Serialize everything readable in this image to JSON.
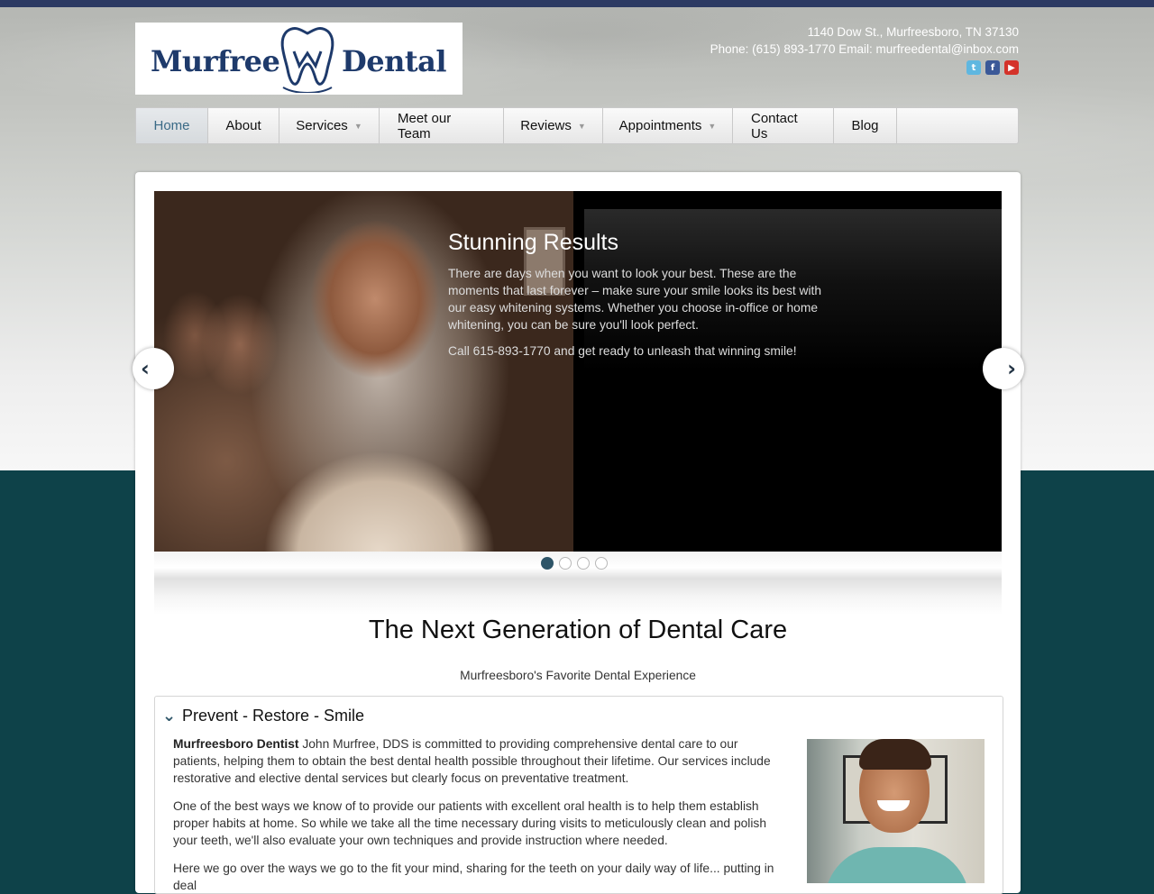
{
  "brand": {
    "name_left": "Murfree",
    "name_right": "Dental"
  },
  "header": {
    "address": "1140 Dow St., Murfreesboro, TN 37130",
    "phone_email": "Phone: (615) 893-1770 Email: murfreedental@inbox.com",
    "social": [
      "twitter-icon",
      "facebook-icon",
      "youtube-icon"
    ]
  },
  "nav": {
    "items": [
      {
        "label": "Home",
        "active": true
      },
      {
        "label": "About"
      },
      {
        "label": "Services",
        "dropdown": true
      },
      {
        "label": "Meet our Team"
      },
      {
        "label": "Reviews",
        "dropdown": true
      },
      {
        "label": "Appointments",
        "dropdown": true
      },
      {
        "label": "Contact Us"
      },
      {
        "label": "Blog"
      }
    ]
  },
  "slider": {
    "title": "Stunning Results",
    "text": "There are days when you want to look your best.  These are the moments that last forever – make sure your smile looks its best with our easy whitening systems.  Whether you choose in-office or home whitening, you can be sure you'll look perfect.",
    "cta": "Call 615-893-1770 and get ready to unleash that winning smile!",
    "slides": 4,
    "active_slide": 1
  },
  "main": {
    "tagline": "The Next Generation of Dental Care",
    "subtag": "Murfreesboro's Favorite Dental Experience",
    "section_title": "Prevent - Restore - Smile",
    "p1_bold": "Murfreesboro Dentist",
    "p1_rest": " John Murfree, DDS is committed to providing comprehensive dental care to our patients, helping them to obtain the best dental health possible throughout their lifetime. Our services include restorative and elective dental services but clearly focus on preventative treatment.",
    "p2": "One of the best ways we know of to provide our patients with excellent oral health is to help them establish proper habits at home. So while we take all the time necessary during visits to meticulously clean and polish your teeth, we'll also evaluate your own techniques and provide instruction where needed.",
    "p3": "Here we go over the ways we go to the fit your mind, sharing for the teeth on your daily way of life... putting in deal"
  },
  "colors": {
    "topbar": "#2c3a63",
    "accent": "#2e5568",
    "footer_band": "#0e4249"
  }
}
